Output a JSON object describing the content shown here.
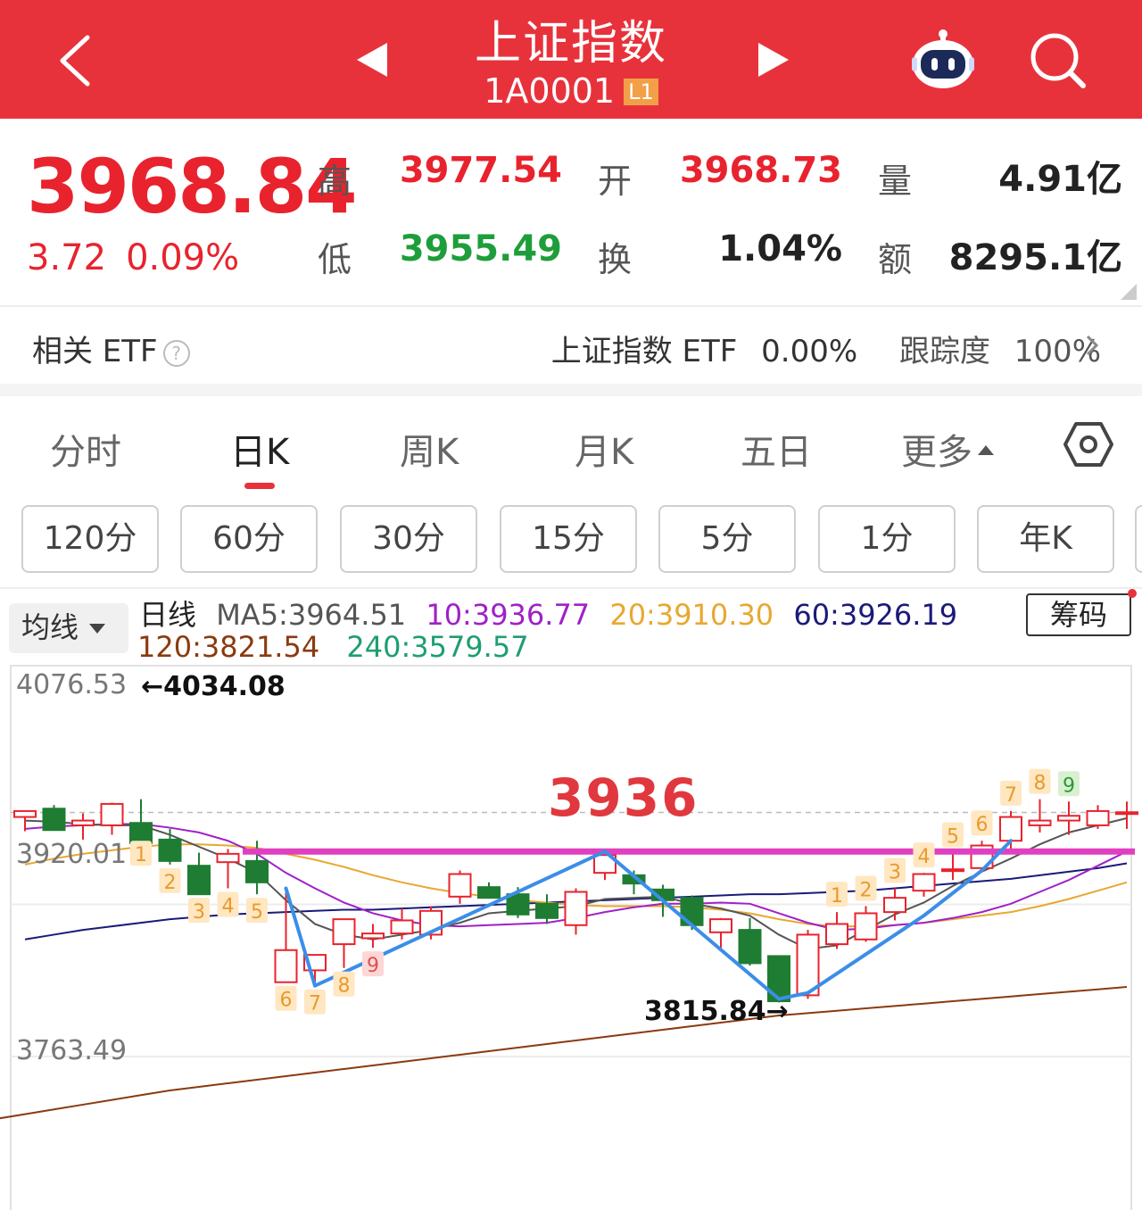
{
  "header": {
    "title": "上证指数",
    "code": "1A0001",
    "level_badge": "L1"
  },
  "quote": {
    "price": "3968.84",
    "change": "3.72",
    "change_pct": "0.09%",
    "high_label": "高",
    "high": "3977.54",
    "low_label": "低",
    "low": "3955.49",
    "open_label": "开",
    "open": "3968.73",
    "turnover_label": "换",
    "turnover": "1.04%",
    "volume_label": "量",
    "volume": "4.91亿",
    "amount_label": "额",
    "amount": "8295.1亿"
  },
  "etf": {
    "label": "相关 ETF",
    "help": "?",
    "name": "上证指数 ETF",
    "change": "0.00%",
    "tracking_label": "跟踪度",
    "tracking": "100%"
  },
  "tabs": [
    "分时",
    "日K",
    "周K",
    "月K",
    "五日",
    "更多"
  ],
  "active_tab": "日K",
  "periods": [
    "120分",
    "60分",
    "30分",
    "15分",
    "5分",
    "1分",
    "年K"
  ],
  "ma_legend": {
    "button": "均线",
    "prefix": "日线",
    "ma5": "MA5:3964.51",
    "ma10": "10:3936.77",
    "ma20": "20:3910.30",
    "ma60": "60:3926.19",
    "ma120": "120:3821.54",
    "ma240": "240:3579.57",
    "chips_button": "筹码"
  },
  "colors": {
    "brand": "#e8323b",
    "up": "#e8232e",
    "down": "#1e7d32",
    "ma5": "#555555",
    "ma10": "#a020c8",
    "ma20": "#e8a830",
    "ma60": "#1a1a7a",
    "ma120": "#8b3a10",
    "ma240": "#1e9e70",
    "level_line": "#e040c0",
    "trend_line": "#3b8ee8"
  },
  "chart_data": {
    "type": "candlestick",
    "y_labels": [
      "4076.53",
      "3920.01",
      "3763.49"
    ],
    "max_annotation": "←4034.08",
    "min_annotation": "3815.84→",
    "level": 3936,
    "level_label": "3936",
    "candles": [
      {
        "o": 3965,
        "h": 3970,
        "l": 3953,
        "c": 3970
      },
      {
        "o": 3972,
        "h": 3975,
        "l": 3955,
        "c": 3954
      },
      {
        "o": 3958,
        "h": 3968,
        "l": 3946,
        "c": 3962
      },
      {
        "o": 3958,
        "h": 3977,
        "l": 3950,
        "c": 3976
      },
      {
        "o": 3960,
        "h": 3980,
        "l": 3948,
        "c": 3943
      },
      {
        "o": 3946,
        "h": 3955,
        "l": 3925,
        "c": 3928
      },
      {
        "o": 3924,
        "h": 3935,
        "l": 3900,
        "c": 3900
      },
      {
        "o": 3927,
        "h": 3938,
        "l": 3905,
        "c": 3934
      },
      {
        "o": 3928,
        "h": 3945,
        "l": 3900,
        "c": 3910
      },
      {
        "o": 3826,
        "h": 3905,
        "l": 3826,
        "c": 3853
      },
      {
        "o": 3836,
        "h": 3848,
        "l": 3823,
        "c": 3849
      },
      {
        "o": 3858,
        "h": 3878,
        "l": 3838,
        "c": 3879
      },
      {
        "o": 3863,
        "h": 3875,
        "l": 3855,
        "c": 3867
      },
      {
        "o": 3867,
        "h": 3888,
        "l": 3862,
        "c": 3878
      },
      {
        "o": 3866,
        "h": 3890,
        "l": 3862,
        "c": 3886
      },
      {
        "o": 3898,
        "h": 3920,
        "l": 3892,
        "c": 3917
      },
      {
        "o": 3906,
        "h": 3910,
        "l": 3898,
        "c": 3897
      },
      {
        "o": 3900,
        "h": 3906,
        "l": 3880,
        "c": 3883
      },
      {
        "o": 3892,
        "h": 3900,
        "l": 3875,
        "c": 3880
      },
      {
        "o": 3874,
        "h": 3905,
        "l": 3866,
        "c": 3902
      },
      {
        "o": 3918,
        "h": 3935,
        "l": 3912,
        "c": 3933
      },
      {
        "o": 3916,
        "h": 3920,
        "l": 3900,
        "c": 3909
      },
      {
        "o": 3904,
        "h": 3908,
        "l": 3881,
        "c": 3895
      },
      {
        "o": 3897,
        "h": 3899,
        "l": 3870,
        "c": 3874
      },
      {
        "o": 3868,
        "h": 3880,
        "l": 3855,
        "c": 3879
      },
      {
        "o": 3870,
        "h": 3880,
        "l": 3840,
        "c": 3842
      },
      {
        "o": 3848,
        "h": 3848,
        "l": 3809,
        "c": 3810
      },
      {
        "o": 3815,
        "h": 3870,
        "l": 3812,
        "c": 3866
      },
      {
        "o": 3858,
        "h": 3885,
        "l": 3854,
        "c": 3875
      },
      {
        "o": 3862,
        "h": 3890,
        "l": 3860,
        "c": 3884
      },
      {
        "o": 3885,
        "h": 3905,
        "l": 3878,
        "c": 3897
      },
      {
        "o": 3903,
        "h": 3918,
        "l": 3898,
        "c": 3917
      },
      {
        "o": 3920,
        "h": 3935,
        "l": 3912,
        "c": 3921
      },
      {
        "o": 3922,
        "h": 3945,
        "l": 3920,
        "c": 3941
      },
      {
        "o": 3945,
        "h": 3970,
        "l": 3936,
        "c": 3965
      },
      {
        "o": 3958,
        "h": 3980,
        "l": 3952,
        "c": 3962
      },
      {
        "o": 3962,
        "h": 3978,
        "l": 3950,
        "c": 3966
      },
      {
        "o": 3958,
        "h": 3975,
        "l": 3955,
        "c": 3970
      },
      {
        "o": 3968,
        "h": 3978,
        "l": 3955,
        "c": 3969
      }
    ],
    "counts": [
      {
        "i": 4,
        "t": "1"
      },
      {
        "i": 5,
        "t": "2"
      },
      {
        "i": 6,
        "t": "3"
      },
      {
        "i": 7,
        "t": "4"
      },
      {
        "i": 8,
        "t": "5"
      },
      {
        "i": 9,
        "t": "6"
      },
      {
        "i": 10,
        "t": "7"
      },
      {
        "i": 11,
        "t": "8"
      },
      {
        "i": 12,
        "t": "9"
      },
      {
        "i": 28,
        "t": "1"
      },
      {
        "i": 29,
        "t": "2"
      },
      {
        "i": 30,
        "t": "3"
      },
      {
        "i": 31,
        "t": "4"
      },
      {
        "i": 32,
        "t": "5"
      },
      {
        "i": 33,
        "t": "6"
      },
      {
        "i": 34,
        "t": "7"
      },
      {
        "i": 35,
        "t": "8"
      },
      {
        "i": 36,
        "t": "9"
      }
    ],
    "ma_lines": {
      "ma5": [
        3962,
        3961,
        3959,
        3958,
        3958,
        3950,
        3940,
        3930,
        3918,
        3895,
        3875,
        3866,
        3862,
        3866,
        3870,
        3876,
        3884,
        3886,
        3888,
        3890,
        3896,
        3897,
        3898,
        3892,
        3888,
        3882,
        3866,
        3854,
        3857,
        3870,
        3883,
        3893,
        3907,
        3919,
        3930,
        3942,
        3952,
        3958,
        3964
      ],
      "ma10": [
        3955,
        3957,
        3958,
        3959,
        3959,
        3956,
        3952,
        3945,
        3934,
        3918,
        3905,
        3893,
        3884,
        3878,
        3874,
        3873,
        3874,
        3875,
        3876,
        3880,
        3885,
        3889,
        3892,
        3892,
        3893,
        3892,
        3884,
        3876,
        3870,
        3871,
        3874,
        3876,
        3880,
        3885,
        3892,
        3902,
        3912,
        3924,
        3936
      ],
      "ma20": [
        3925,
        3930,
        3934,
        3937,
        3940,
        3942,
        3942,
        3941,
        3939,
        3934,
        3929,
        3923,
        3916,
        3910,
        3905,
        3901,
        3898,
        3895,
        3893,
        3891,
        3890,
        3890,
        3890,
        3889,
        3887,
        3884,
        3879,
        3875,
        3873,
        3873,
        3874,
        3876,
        3879,
        3882,
        3885,
        3890,
        3896,
        3903,
        3910
      ],
      "ma60": [
        3862,
        3866,
        3870,
        3873,
        3876,
        3879,
        3881,
        3883,
        3884,
        3885,
        3886,
        3887,
        3887,
        3888,
        3889,
        3890,
        3891,
        3892,
        3893,
        3894,
        3895,
        3896,
        3897,
        3898,
        3899,
        3900,
        3900,
        3901,
        3902,
        3903,
        3905,
        3907,
        3909,
        3911,
        3913,
        3916,
        3919,
        3922,
        3926
      ],
      "ma120": [
        3715,
        3719,
        3723,
        3727,
        3731,
        3735,
        3738,
        3741,
        3744,
        3747,
        3750,
        3753,
        3756,
        3759,
        3762,
        3765,
        3768,
        3771,
        3774,
        3777,
        3780,
        3783,
        3786,
        3789,
        3792,
        3795,
        3798,
        3800,
        3802,
        3804,
        3806,
        3808,
        3810,
        3812,
        3814,
        3816,
        3818,
        3820,
        3822
      ]
    },
    "trend_path": [
      {
        "i": 9,
        "v": 3905
      },
      {
        "i": 10,
        "v": 3823
      },
      {
        "i": 20,
        "v": 3936
      },
      {
        "i": 26,
        "v": 3812
      },
      {
        "i": 27,
        "v": 3817
      },
      {
        "i": 31,
        "v": 3882
      },
      {
        "i": 33,
        "v": 3920
      },
      {
        "i": 34,
        "v": 3945
      }
    ]
  }
}
